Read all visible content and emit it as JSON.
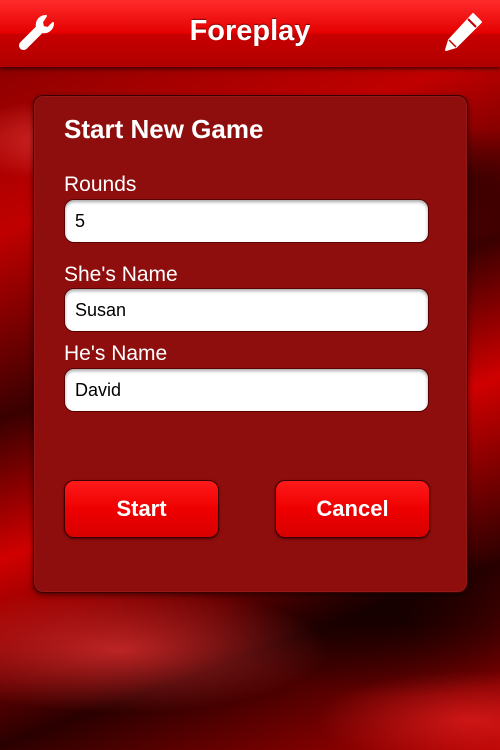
{
  "header": {
    "title": "Foreplay",
    "left_icon": "wrench-icon",
    "right_icon": "pencil-icon"
  },
  "form": {
    "title": "Start New Game",
    "rounds_label": "Rounds",
    "rounds_value": "5",
    "she_label": "She's Name",
    "she_value": "Susan",
    "he_label": "He's Name",
    "he_value": "David",
    "start_label": "Start",
    "cancel_label": "Cancel"
  },
  "colors": {
    "accent": "#e40000",
    "panel": "#8e0d0d"
  }
}
